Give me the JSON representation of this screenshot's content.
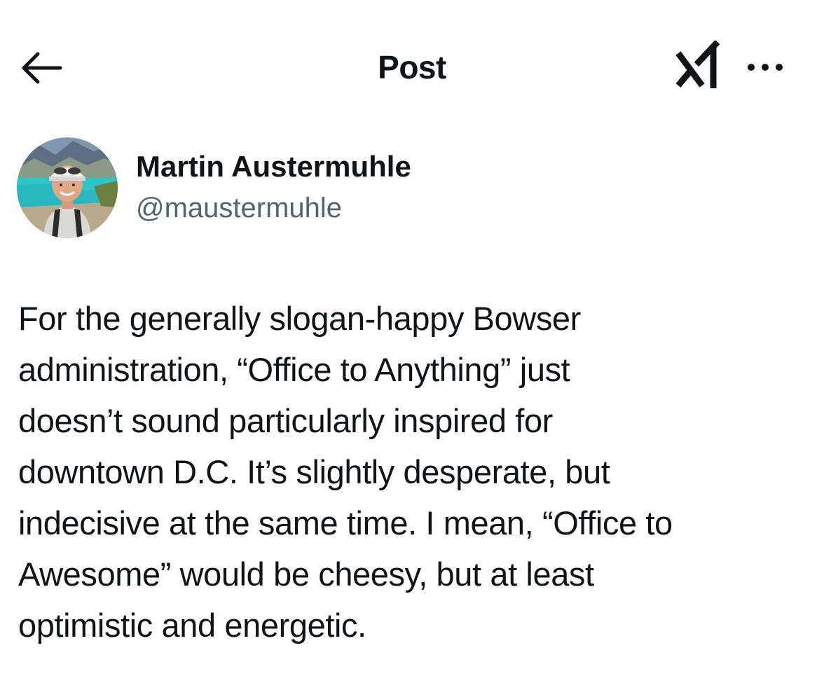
{
  "header": {
    "title": "Post",
    "back_icon": "arrow-left-icon",
    "grok_icon": "grok-logo-icon",
    "more_icon": "more-horizontal-icon"
  },
  "author": {
    "display_name": "Martin Austermuhle",
    "handle": "@maustermuhle",
    "avatar_icon": "profile-photo"
  },
  "post": {
    "lines": [
      "For the generally slogan-happy Bowser",
      "administration, “Office to Anything” just",
      "doesn’t sound particularly inspired for",
      "downtown D.C. It’s slightly desperate, but",
      "indecisive at the same time. I mean, “Office to",
      "Awesome” would be cheesy, but at least",
      "optimistic and energetic."
    ]
  },
  "colors": {
    "text_primary": "#0f1419",
    "text_secondary": "#536471",
    "background": "#ffffff"
  }
}
